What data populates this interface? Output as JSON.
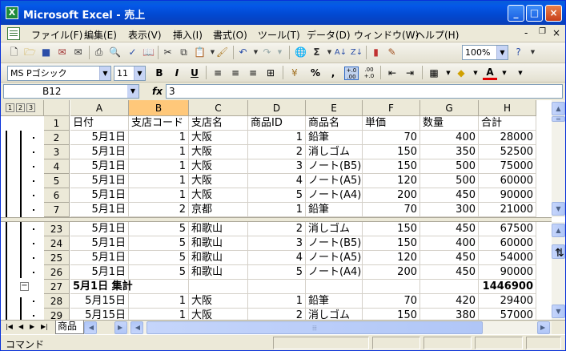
{
  "window": {
    "title": "Microsoft Excel - 売上",
    "app_icon_label": "X"
  },
  "window_controls": {
    "minimize": "_",
    "maximize": "□",
    "close": "×"
  },
  "menubar": {
    "items": [
      "ファイル(F)",
      "編集(E)",
      "表示(V)",
      "挿入(I)",
      "書式(O)",
      "ツール(T)",
      "データ(D)",
      "ウィンドウ(W)",
      "ヘルプ(H)"
    ],
    "doc_controls": [
      "-",
      "×"
    ]
  },
  "standard_toolbar": {
    "zoom": "100%",
    "autosum": "Σ"
  },
  "formatting_toolbar": {
    "font_name": "MS Pゴシック",
    "font_size": "11",
    "bold": "B",
    "italic": "I",
    "underline": "U",
    "percent": "%",
    "comma": ",",
    "inc_decimal": "+.0\n.00",
    "dec_decimal": ".00\n+.0",
    "font_color_label": "A"
  },
  "formula_bar": {
    "name_box": "B12",
    "fx": "fx",
    "value": "3"
  },
  "outline_levels": [
    "1",
    "2",
    "3"
  ],
  "columns": [
    {
      "letter": "A"
    },
    {
      "letter": "B"
    },
    {
      "letter": "C"
    },
    {
      "letter": "D"
    },
    {
      "letter": "E"
    },
    {
      "letter": "F"
    },
    {
      "letter": "G"
    },
    {
      "letter": "H"
    }
  ],
  "rows_top": [
    {
      "num": "1",
      "cells": [
        "日付",
        "支店コード",
        "支店名",
        "商品ID",
        "商品名",
        "単価",
        "数量",
        "合計"
      ]
    },
    {
      "num": "2",
      "cells": [
        "5月1日",
        "1",
        "大阪",
        "1",
        "鉛筆",
        "70",
        "400",
        "28000"
      ]
    },
    {
      "num": "3",
      "cells": [
        "5月1日",
        "1",
        "大阪",
        "2",
        "消しゴム",
        "150",
        "350",
        "52500"
      ]
    },
    {
      "num": "4",
      "cells": [
        "5月1日",
        "1",
        "大阪",
        "3",
        "ノート(B5)",
        "150",
        "500",
        "75000"
      ]
    },
    {
      "num": "5",
      "cells": [
        "5月1日",
        "1",
        "大阪",
        "4",
        "ノート(A5)",
        "120",
        "500",
        "60000"
      ]
    },
    {
      "num": "6",
      "cells": [
        "5月1日",
        "1",
        "大阪",
        "5",
        "ノート(A4)",
        "200",
        "450",
        "90000"
      ]
    },
    {
      "num": "7",
      "cells": [
        "5月1日",
        "2",
        "京都",
        "1",
        "鉛筆",
        "70",
        "300",
        "21000"
      ]
    }
  ],
  "rows_bottom": [
    {
      "num": "23",
      "cells": [
        "5月1日",
        "5",
        "和歌山",
        "2",
        "消しゴム",
        "150",
        "450",
        "67500"
      ]
    },
    {
      "num": "24",
      "cells": [
        "5月1日",
        "5",
        "和歌山",
        "3",
        "ノート(B5)",
        "150",
        "400",
        "60000"
      ]
    },
    {
      "num": "25",
      "cells": [
        "5月1日",
        "5",
        "和歌山",
        "4",
        "ノート(A5)",
        "120",
        "450",
        "54000"
      ]
    },
    {
      "num": "26",
      "cells": [
        "5月1日",
        "5",
        "和歌山",
        "5",
        "ノート(A4)",
        "200",
        "450",
        "90000"
      ]
    },
    {
      "num": "27",
      "cells": [
        "5月1日 集計",
        "",
        "",
        "",
        "",
        "",
        "",
        "1446900"
      ]
    },
    {
      "num": "28",
      "cells": [
        "5月15日",
        "1",
        "大阪",
        "1",
        "鉛筆",
        "70",
        "420",
        "29400"
      ]
    },
    {
      "num": "29",
      "cells": [
        "5月15日",
        "1",
        "大阪",
        "2",
        "消しゴム",
        "150",
        "380",
        "57000"
      ]
    }
  ],
  "outline_collapse_symbol": "−",
  "sheet_tab": "商品",
  "status": "コマンド"
}
